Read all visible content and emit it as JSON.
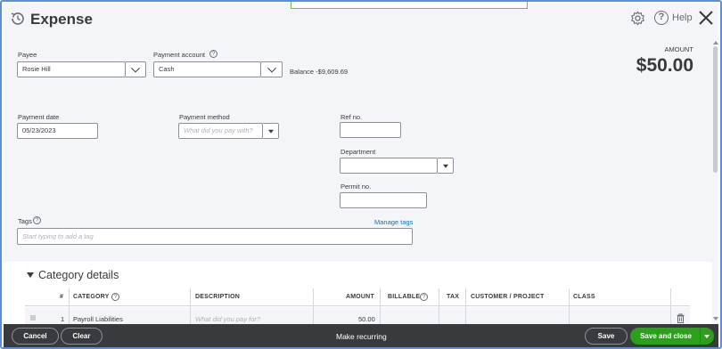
{
  "header": {
    "title": "Expense",
    "help_label": "Help"
  },
  "form": {
    "payee_label": "Payee",
    "payee_value": "Rosie Hill",
    "account_label": "Payment account",
    "account_value": "Cash",
    "balance_text": "Balance -$9,609.69",
    "amount_label": "AMOUNT",
    "amount_value": "$50.00",
    "date_label": "Payment date",
    "date_value": "05/23/2023",
    "method_label": "Payment method",
    "method_placeholder": "What did you pay with?",
    "ref_label": "Ref no.",
    "ref_value": "",
    "department_label": "Department",
    "department_value": "",
    "permit_label": "Permit no.",
    "permit_value": "",
    "tags_label": "Tags",
    "manage_tags": "Manage tags",
    "tags_placeholder": "Start typing to add a tag"
  },
  "category": {
    "section_title": "Category details",
    "columns": [
      "#",
      "CATEGORY",
      "DESCRIPTION",
      "AMOUNT",
      "BILLABLE",
      "TAX",
      "CUSTOMER / PROJECT",
      "CLASS"
    ],
    "rows": [
      {
        "num": "1",
        "category": "Payroll Liabilities",
        "description_placeholder": "What did you pay for?",
        "amount": "50.00"
      }
    ]
  },
  "footer": {
    "cancel": "Cancel",
    "clear": "Clear",
    "make_recurring": "Make recurring",
    "save": "Save",
    "save_close": "Save and close"
  },
  "colors": {
    "accent_green": "#2ca01c",
    "footer_bg": "#393a3d",
    "link": "#0077c5"
  }
}
